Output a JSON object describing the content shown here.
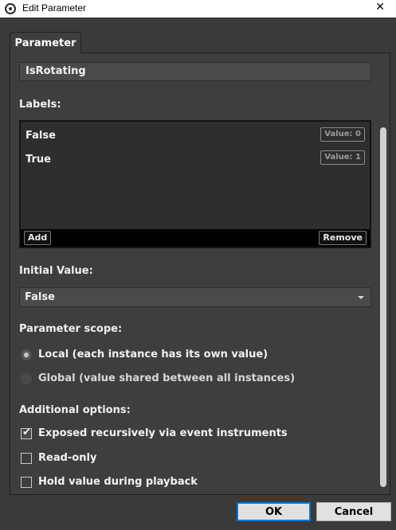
{
  "window": {
    "title": "Edit Parameter",
    "close_glyph": "✕",
    "app_icon": "fmod-studio-icon"
  },
  "tab": {
    "label": "Parameter"
  },
  "name_field": {
    "value": "IsRotating"
  },
  "labels_section": {
    "heading": "Labels:",
    "items": [
      {
        "label": "False",
        "value_badge": "Value: 0"
      },
      {
        "label": "True",
        "value_badge": "Value: 1"
      }
    ],
    "add_label": "Add",
    "remove_label": "Remove"
  },
  "initial_value": {
    "heading": "Initial Value:",
    "selected": "False"
  },
  "scope": {
    "heading": "Parameter scope:",
    "local_label": "Local (each instance has its own value)",
    "global_label": "Global (value shared between all instances)",
    "selected": "local"
  },
  "additional": {
    "heading": "Additional options:",
    "options": [
      {
        "label": "Exposed recursively via event instruments",
        "checked": true
      },
      {
        "label": "Read-only",
        "checked": false
      },
      {
        "label": "Hold value during playback",
        "checked": false
      }
    ]
  },
  "buttons": {
    "ok": "OK",
    "cancel": "Cancel"
  },
  "colors": {
    "background": "#3a3a3a",
    "panel": "#3e3e3e",
    "default_button_border": "#0078d7"
  }
}
